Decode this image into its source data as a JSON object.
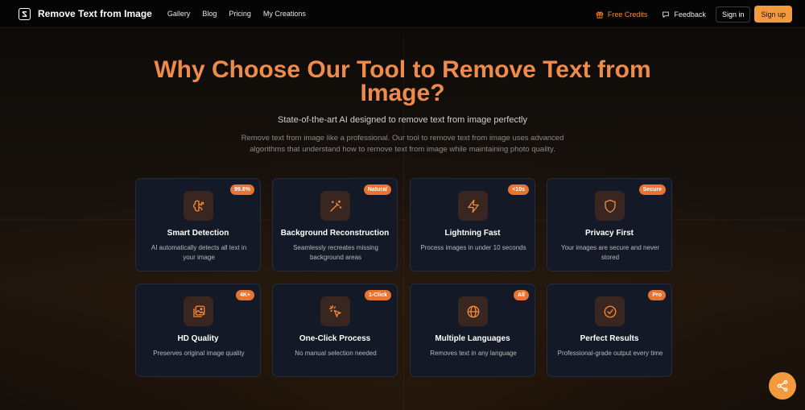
{
  "nav": {
    "brand": "Remove Text from Image",
    "links": [
      "Gallery",
      "Blog",
      "Pricing",
      "My Creations"
    ],
    "free_credits": "Free Credits",
    "feedback": "Feedback",
    "sign_in": "Sign in",
    "sign_up": "Sign up"
  },
  "hero": {
    "title": "Why Choose Our Tool to Remove Text from Image?",
    "subtitle": "State-of-the-art AI designed to remove text from image perfectly",
    "description": "Remove text from image like a professional. Our tool to remove text from image uses advanced algorithms that understand how to remove text from image while maintaining photo quality."
  },
  "features": [
    {
      "badge": "99.8%",
      "title": "Smart Detection",
      "desc": "AI automatically detects all text in your image",
      "icon": "brain-icon"
    },
    {
      "badge": "Natural",
      "title": "Background Reconstruction",
      "desc": "Seamlessly recreates missing background areas",
      "icon": "magic-wand-icon"
    },
    {
      "badge": "<10s",
      "title": "Lightning Fast",
      "desc": "Process images in under 10 seconds",
      "icon": "lightning-icon"
    },
    {
      "badge": "Secure",
      "title": "Privacy First",
      "desc": "Your images are secure and never stored",
      "icon": "shield-icon"
    },
    {
      "badge": "4K+",
      "title": "HD Quality",
      "desc": "Preserves original image quality",
      "icon": "images-icon"
    },
    {
      "badge": "1-Click",
      "title": "One-Click Process",
      "desc": "No manual selection needed",
      "icon": "click-cursor-icon"
    },
    {
      "badge": "All",
      "title": "Multiple Languages",
      "desc": "Removes text in any language",
      "icon": "globe-icon"
    },
    {
      "badge": "Pro",
      "title": "Perfect Results",
      "desc": "Professional-grade output every time",
      "icon": "check-circle-icon"
    }
  ],
  "colors": {
    "accent": "#ee8a4a",
    "badge": "#e87332",
    "button": "#f29a3d",
    "card_bg": "#131926",
    "icon_bg": "#3a2620"
  }
}
